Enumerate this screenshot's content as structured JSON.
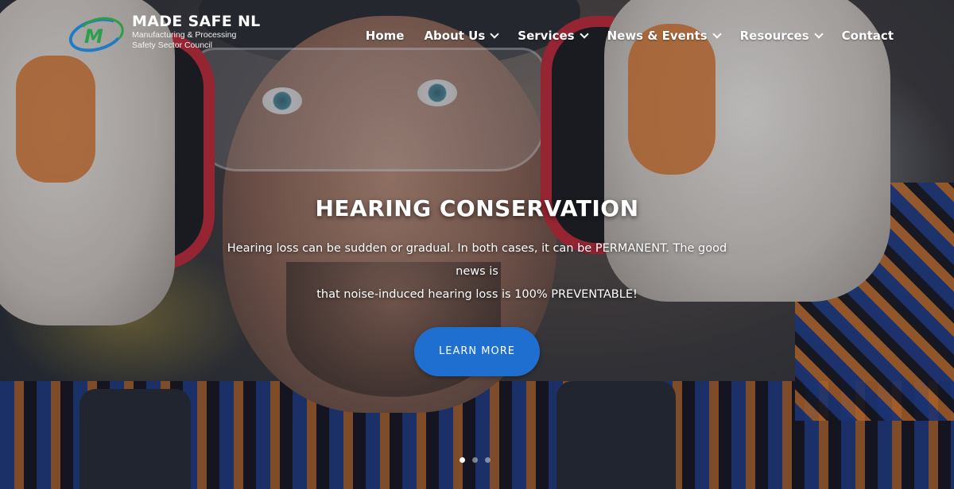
{
  "brand": {
    "name": "MADE SAFE NL",
    "subtitle_line1": "Manufacturing & Processing",
    "subtitle_line2": "Safety Sector Council"
  },
  "nav": {
    "items": [
      {
        "label": "Home",
        "dropdown": false
      },
      {
        "label": "About Us",
        "dropdown": true
      },
      {
        "label": "Services",
        "dropdown": true
      },
      {
        "label": "News & Events",
        "dropdown": true
      },
      {
        "label": "Resources",
        "dropdown": true
      },
      {
        "label": "Contact",
        "dropdown": false
      }
    ]
  },
  "slide": {
    "title": "HEARING CONSERVATION",
    "text_line1": "Hearing loss can be sudden or gradual. In both cases, it can be PERMANENT. The good news is",
    "text_line2": "that noise-induced hearing loss is 100% PREVENTABLE!",
    "button_label": "LEARN MORE"
  },
  "slider": {
    "total_slides": 3,
    "active_index": 0
  },
  "colors": {
    "accent_button": "#1f6fd1",
    "logo_blue": "#1f7cc4",
    "logo_green": "#2aa04a"
  },
  "icons": {
    "dropdown": "chevron-down-icon",
    "logo": "made-safe-logo-icon"
  }
}
